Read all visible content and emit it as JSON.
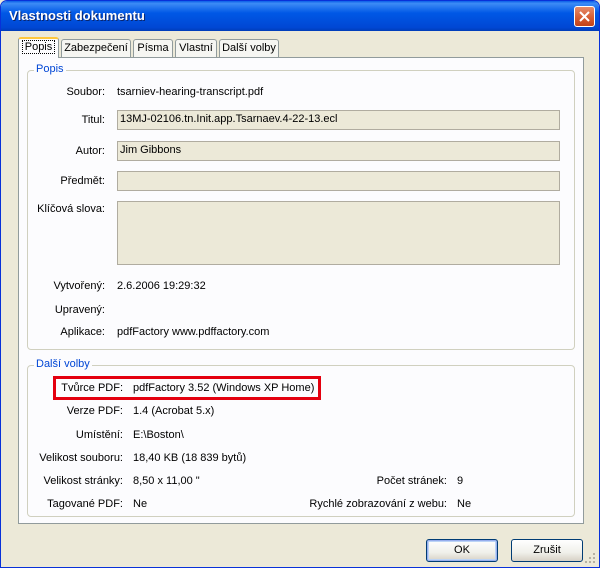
{
  "window": {
    "title": "Vlastnosti dokumentu"
  },
  "tabs": [
    {
      "label": "Popis"
    },
    {
      "label": "Zabezpečení"
    },
    {
      "label": "Písma"
    },
    {
      "label": "Vlastní"
    },
    {
      "label": "Další volby"
    }
  ],
  "description": {
    "group_title": "Popis",
    "file_label": "Soubor:",
    "file_value": "tsarniev-hearing-transcript.pdf",
    "title_label": "Titul:",
    "title_value": "13MJ-02106.tn.Init.app.Tsarnaev.4-22-13.ecl",
    "author_label": "Autor:",
    "author_value": "Jim Gibbons",
    "subject_label": "Předmět:",
    "subject_value": "",
    "keywords_label": "Klíčová slova:",
    "keywords_value": "",
    "created_label": "Vytvořený:",
    "created_value": "2.6.2006 19:29:32",
    "modified_label": "Upravený:",
    "modified_value": "",
    "application_label": "Aplikace:",
    "application_value": "pdfFactory www.pdffactory.com"
  },
  "advanced": {
    "group_title": "Další volby",
    "producer_label": "Tvůrce PDF:",
    "producer_value": "pdfFactory 3.52 (Windows XP Home)",
    "version_label": "Verze PDF:",
    "version_value": "1.4 (Acrobat 5.x)",
    "location_label": "Umístění:",
    "location_value": "E:\\Boston\\",
    "filesize_label": "Velikost souboru:",
    "filesize_value": "18,40 KB (18 839 bytů)",
    "pagesize_label": "Velikost stránky:",
    "pagesize_value": "8,50 x 11,00 \"",
    "pagecount_label": "Počet stránek:",
    "pagecount_value": "9",
    "tagged_label": "Tagované PDF:",
    "tagged_value": "Ne",
    "fastweb_label": "Rychlé zobrazování z webu:",
    "fastweb_value": "Ne"
  },
  "buttons": {
    "ok": "OK",
    "cancel": "Zrušit"
  },
  "colors": {
    "highlight": "#e4000f",
    "titlebar": "#0058e6",
    "group_title": "#0046d5"
  }
}
